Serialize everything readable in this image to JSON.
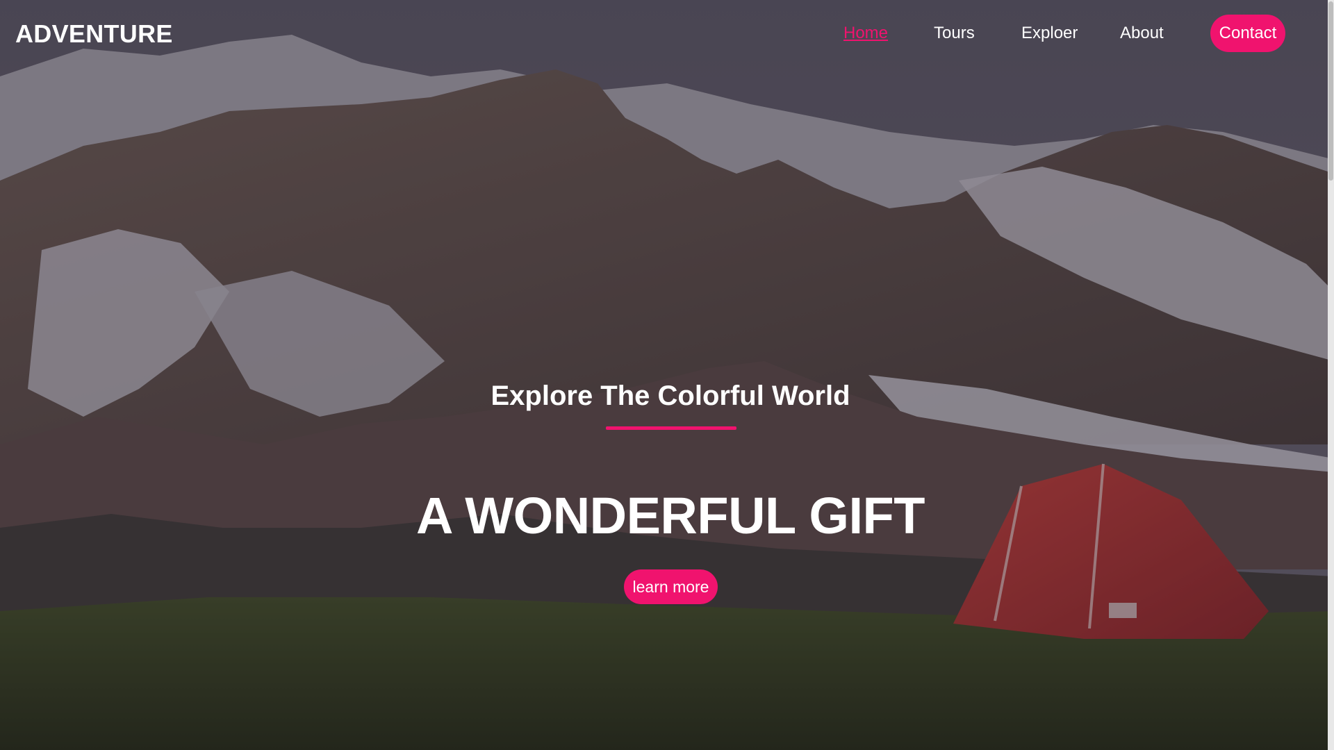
{
  "brand": {
    "logo_text": "ADVENTURE"
  },
  "nav": {
    "links": [
      {
        "label": "Home",
        "active": true
      },
      {
        "label": "Tours",
        "active": false
      },
      {
        "label": "Exploer",
        "active": false
      },
      {
        "label": "About",
        "active": false
      }
    ],
    "contact_label": "Contact"
  },
  "hero": {
    "tagline": "Explore The Colorful World",
    "headline": "A WONDERFUL GIFT",
    "cta_label": "learn more",
    "background_image": "mountain-camping-tent-photo"
  },
  "colors": {
    "accent": "#f0136e",
    "text": "#ffffff",
    "overlay": "#2b2733"
  },
  "icons": []
}
